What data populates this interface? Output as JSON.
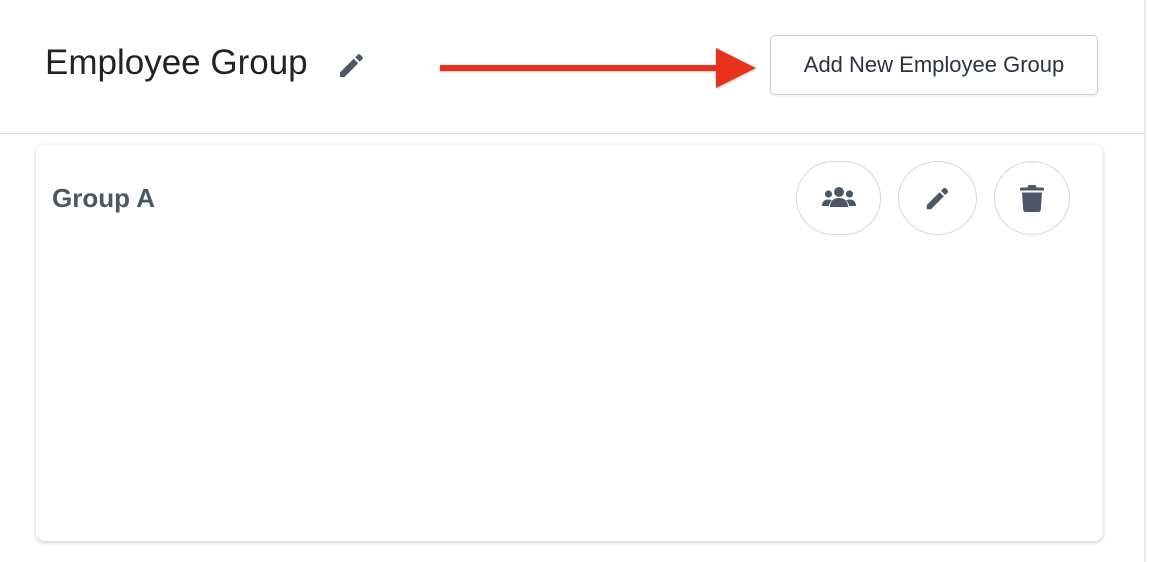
{
  "header": {
    "title": "Employee Group",
    "add_button_label": "Add New Employee Group"
  },
  "group_card": {
    "name": "Group A",
    "actions": [
      {
        "name": "members",
        "icon": "users-icon"
      },
      {
        "name": "edit",
        "icon": "pencil-icon"
      },
      {
        "name": "delete",
        "icon": "trash-icon"
      }
    ]
  },
  "colors": {
    "icon": "#4d5666",
    "arrow": "#e8321f",
    "border": "#d3d7dc"
  }
}
